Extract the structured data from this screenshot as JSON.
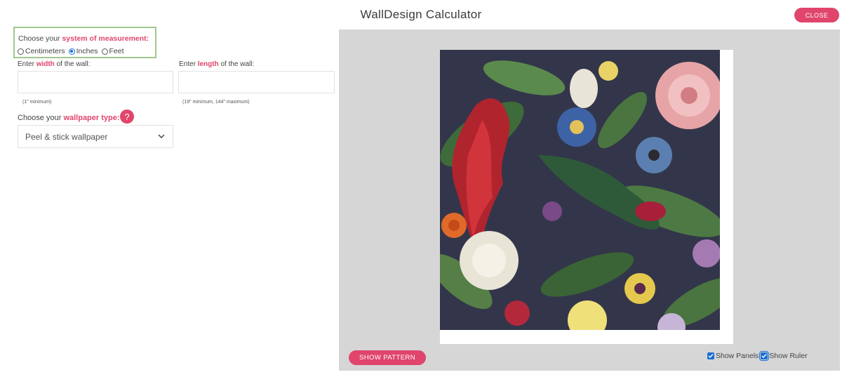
{
  "header": {
    "title": "WallDesign Calculator",
    "close_label": "CLOSE"
  },
  "measurement": {
    "label_prefix": "Choose your ",
    "label_accent": "system of measurement:",
    "options": [
      "Centimeters",
      "Inches",
      "Feet"
    ],
    "selected": "Inches"
  },
  "width": {
    "label_prefix": "Enter ",
    "label_accent": "width",
    "label_suffix": " of the wall:",
    "value": "",
    "hint": "(1\" minimum)"
  },
  "length": {
    "label_prefix": "Enter ",
    "label_accent": "length",
    "label_suffix": " of the wall:",
    "value": "",
    "hint": "(19\" minimum, 144\" maximum)"
  },
  "wallpaper_type": {
    "label_prefix": "Choose your ",
    "label_accent": "wallpaper type:",
    "help_label": "?",
    "selected": "Peel & stick wallpaper"
  },
  "preview": {
    "show_pattern_label": "SHOW PATTERN",
    "show_panels_label": "Show Panels",
    "show_panels_checked": true,
    "show_ruler_label": "Show Ruler",
    "show_ruler_checked": true
  },
  "colors": {
    "accent": "#e0456c",
    "highlight_border": "#9fc98f",
    "preview_bg": "#d6d6d6",
    "checkbox": "#1a6fd6"
  }
}
